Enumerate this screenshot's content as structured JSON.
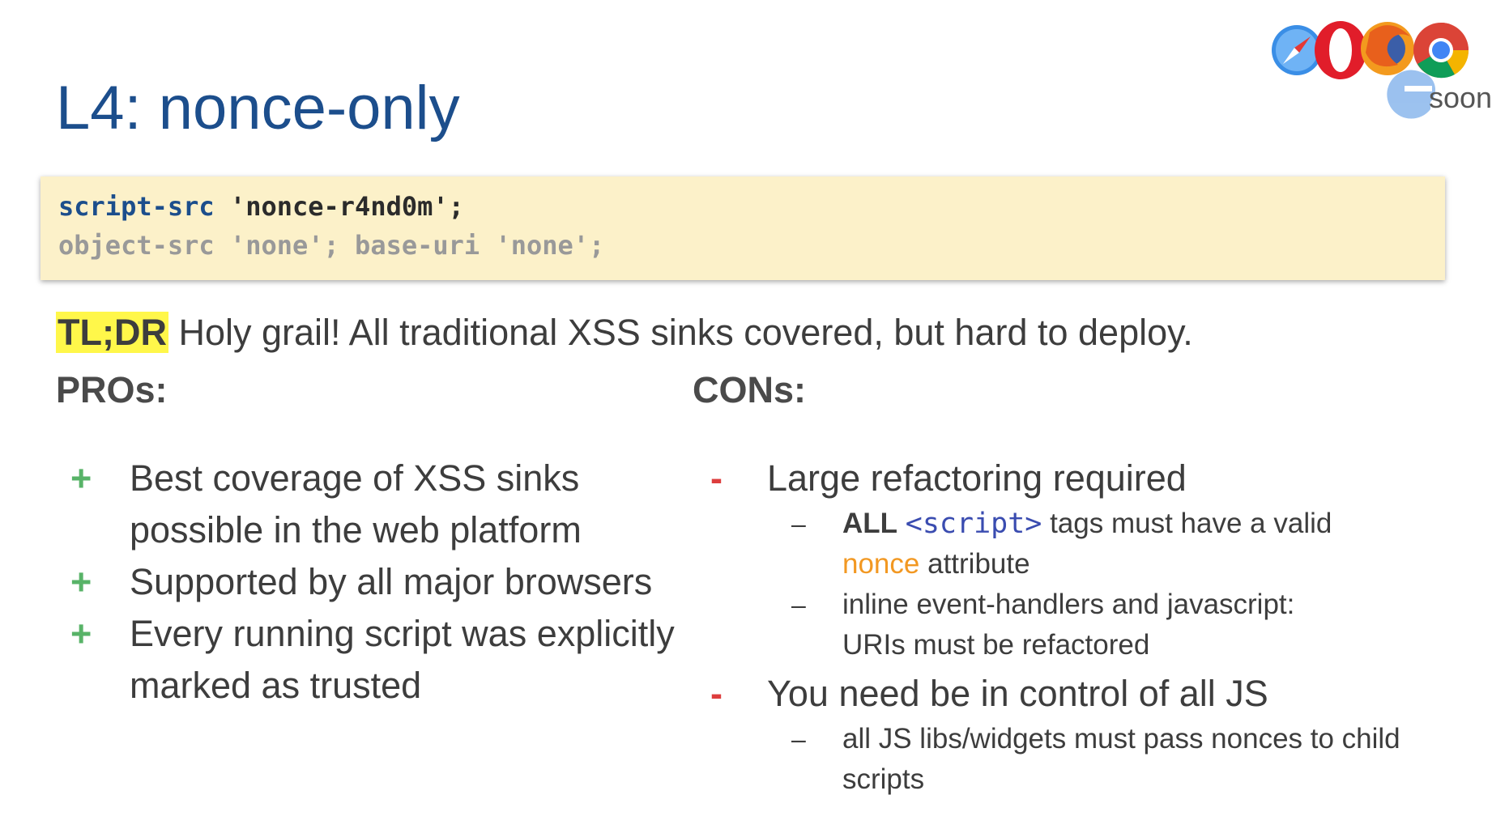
{
  "title": "L4: nonce-only",
  "browsers": {
    "icons": [
      "safari-icon",
      "opera-icon",
      "firefox-icon",
      "chrome-icon",
      "edge-icon"
    ],
    "edge_note": "soon"
  },
  "code": {
    "line1": {
      "directive": "script-src",
      "value": "'nonce-r4nd0m';"
    },
    "line2": {
      "text": "object-src 'none'; base-uri 'none';"
    }
  },
  "tldr": {
    "label": "TL;DR",
    "text": "Holy grail! All traditional XSS sinks covered, but hard to deploy."
  },
  "pros": {
    "heading": "PROs:",
    "marker": "+",
    "items": [
      "Best coverage of XSS sinks possible in the web platform",
      "Supported by all major browsers",
      "Every running script was explicitly marked as trusted"
    ]
  },
  "cons": {
    "heading": "CONs:",
    "marker": "-",
    "sub_marker": "–",
    "items": [
      {
        "text": "Large refactoring required",
        "subs": [
          {
            "bold": "ALL",
            "code": "<script>",
            "mid": "tags must have a valid",
            "highlight": "nonce",
            "end": "attribute"
          },
          {
            "text": "inline event-handlers and javascript: URIs must be refactored"
          }
        ]
      },
      {
        "text": "You need be in control of all JS",
        "subs": [
          {
            "text": "all JS libs/widgets must pass nonces to child scripts"
          }
        ]
      }
    ]
  },
  "colors": {
    "title": "#1c4e8c",
    "code_bg": "#fcf1c9",
    "highlight": "#fff74a",
    "plus": "#58b368",
    "minus": "#dd3d3d",
    "nonce": "#f29822"
  }
}
